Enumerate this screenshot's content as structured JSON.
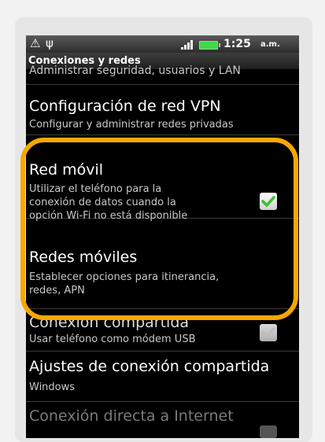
{
  "status_bar": {
    "time": "1:25",
    "ampm": "a.m.",
    "left_icons": [
      "warning-icon",
      "usb-icon"
    ],
    "battery_color": "#3fd94a"
  },
  "title": "Conexiones y redes",
  "items": [
    {
      "title": "",
      "subtitle": "Administrar seguridad, usuarios y LAN"
    },
    {
      "title": "Configuración de red VPN",
      "subtitle": "Configurar y administrar redes privadas"
    },
    {
      "title": "Red móvil",
      "subtitle_lines": [
        "Utilizar el teléfono para la",
        "conexión de datos cuando la",
        "opción Wi-Fi no está disponible"
      ],
      "checked": true
    },
    {
      "title": "Redes móviles",
      "subtitle_lines": [
        "Establecer opciones para itinerancia,",
        "redes, APN"
      ]
    },
    {
      "title": "Conexión compartida",
      "subtitle": "Usar teléfono como módem USB",
      "checked": false
    },
    {
      "title": "Ajustes de conexión compartida",
      "subtitle": "Windows"
    },
    {
      "title": "Conexión directa a Internet",
      "subtitle": "",
      "disabled": true
    }
  ],
  "highlight_color": "#f5a800"
}
